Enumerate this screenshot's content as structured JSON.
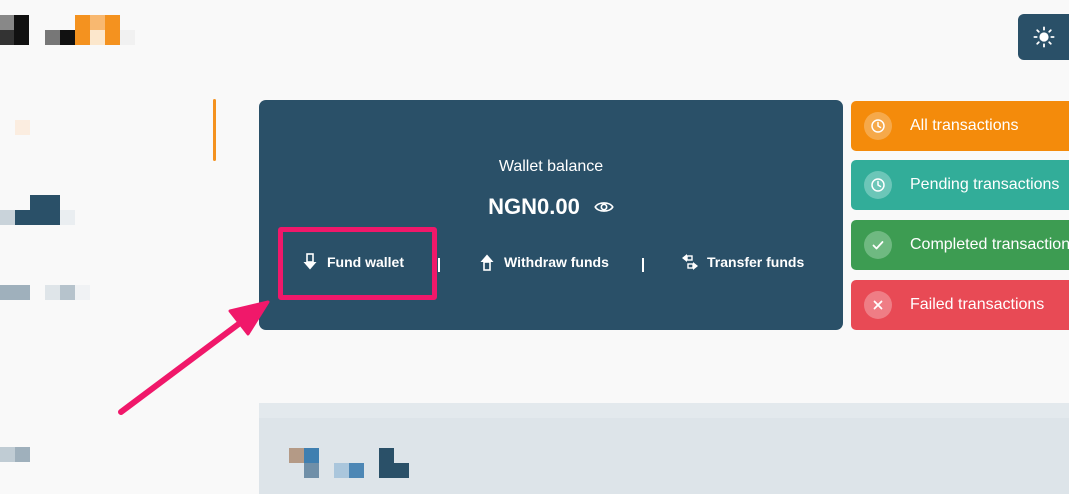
{
  "header": {
    "theme_toggle_icon": "sun-icon"
  },
  "wallet": {
    "title": "Wallet balance",
    "amount": "NGN0.00",
    "toggle_icon": "eye-icon",
    "actions": [
      {
        "label": "Fund wallet",
        "icon": "arrow-down-icon"
      },
      {
        "label": "Withdraw funds",
        "icon": "arrow-up-icon"
      },
      {
        "label": "Transfer funds",
        "icon": "transfer-icon"
      }
    ]
  },
  "transactions": [
    {
      "label": "All transactions",
      "icon": "clock-icon",
      "color": "#f48b0b"
    },
    {
      "label": "Pending transactions",
      "icon": "clock-icon",
      "color": "#32ad99"
    },
    {
      "label": "Completed transactions",
      "icon": "check-icon",
      "color": "#3d9c52"
    },
    {
      "label": "Failed transactions",
      "icon": "x-icon",
      "color": "#e84a55"
    }
  ],
  "colors": {
    "primary": "#2a5068",
    "accent": "#f4921f",
    "highlight": "#f0186a"
  }
}
